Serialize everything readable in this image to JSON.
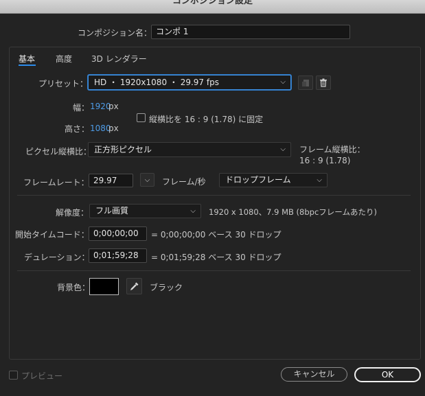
{
  "window": {
    "title": "コンポジション設定"
  },
  "comp_name": {
    "label": "コンポジション名：",
    "value": "コンポ 1"
  },
  "tabs": [
    {
      "label": "基本",
      "active": true
    },
    {
      "label": "高度",
      "active": false
    },
    {
      "label": "3D レンダラー",
      "active": false
    }
  ],
  "preset": {
    "label": "プリセット：",
    "value": "HD ・ 1920x1080 ・ 29.97 fps",
    "save_icon": "save-preset-icon",
    "delete_icon": "trash-icon"
  },
  "size": {
    "width_label": "幅：",
    "width_value": "1920",
    "width_unit": "px",
    "height_label": "高さ：",
    "height_value": "1080",
    "height_unit": "px",
    "lock_aspect_label": "縦横比を 16 : 9 (1.78) に固定",
    "lock_aspect_checked": false
  },
  "pixel_aspect": {
    "label": "ピクセル縦横比：",
    "value": "正方形ピクセル",
    "frame_aspect_label": "フレーム縦横比：",
    "frame_aspect_value": "16 : 9 (1.78)"
  },
  "frame_rate": {
    "label": "フレームレート：",
    "value": "29.97",
    "unit": "フレーム/秒",
    "drop_mode": "ドロップフレーム"
  },
  "resolution": {
    "label": "解像度：",
    "value": "フル画質",
    "info": "1920 x 1080、7.9 MB (8bpcフレームあたり)"
  },
  "start_timecode": {
    "label": "開始タイムコード：",
    "value": "0;00;00;00",
    "info": "= 0;00;00;00  ベース 30   ドロップ"
  },
  "duration": {
    "label": "デュレーション：",
    "value": "0;01;59;28",
    "info": "= 0;01;59;28  ベース 30   ドロップ"
  },
  "background": {
    "label": "背景色：",
    "color": "#000000",
    "color_name": "ブラック"
  },
  "footer": {
    "preview_label": "プレビュー",
    "cancel_label": "キャンセル",
    "ok_label": "OK"
  },
  "colors": {
    "accent": "#4d9be6",
    "tab_underline": "#2d8ceb"
  }
}
